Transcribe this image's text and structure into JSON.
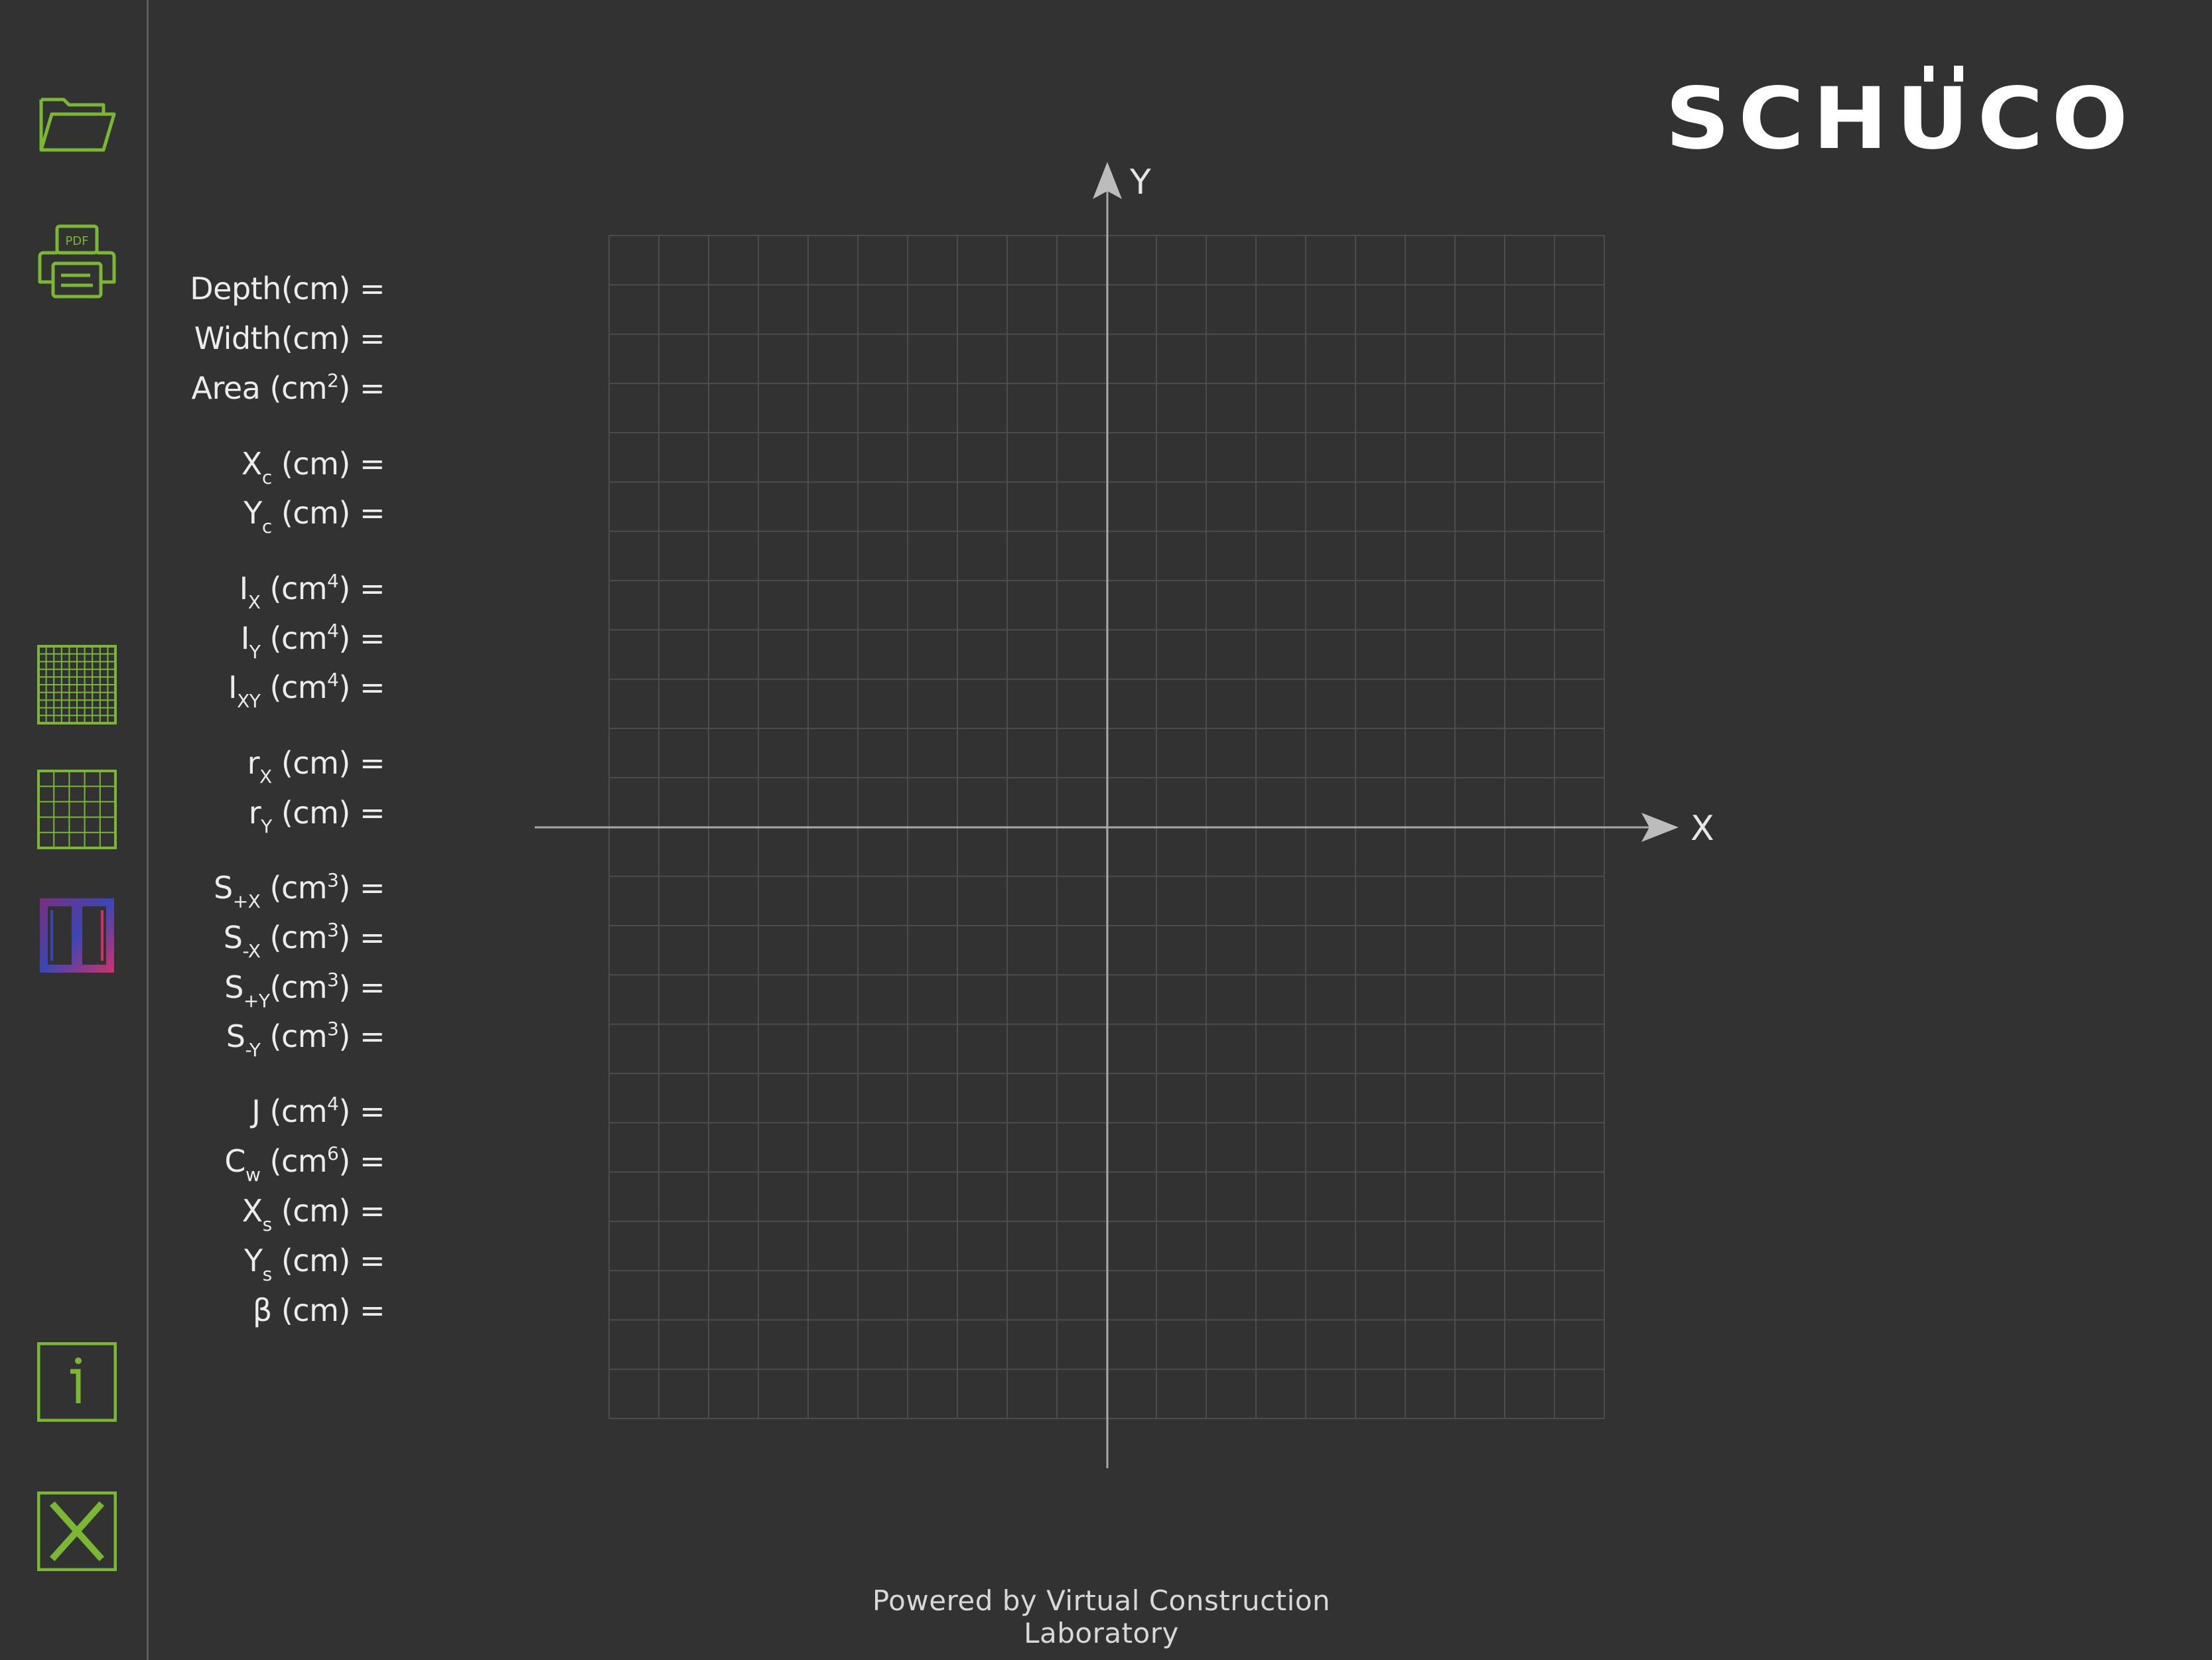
{
  "brand": {
    "logo_text": "SCHÜCO"
  },
  "sidebar": {
    "items": [
      {
        "name": "open-folder",
        "icon": "folder-icon"
      },
      {
        "name": "print-pdf",
        "icon": "pdf-printer-icon",
        "icon_text": "PDF"
      },
      {
        "name": "fine-grid",
        "icon": "fine-grid-icon"
      },
      {
        "name": "coarse-grid",
        "icon": "coarse-grid-icon"
      },
      {
        "name": "section-view",
        "icon": "section-profile-icon"
      },
      {
        "name": "info",
        "icon": "info-icon"
      },
      {
        "name": "close",
        "icon": "close-x-icon"
      }
    ],
    "accent_color": "#7ab833",
    "section_colors": [
      "#7a2f7f",
      "#3b46b5",
      "#d1306b"
    ]
  },
  "properties": [
    {
      "key": "depth",
      "main": "Depth(cm) ="
    },
    {
      "key": "width",
      "main": "Width(cm) ="
    },
    {
      "key": "area",
      "main": "Area (cm",
      "sup": "2",
      "tail": ") ="
    },
    {
      "key": "xc",
      "main": "X",
      "sub": "c",
      "tail": " (cm) ="
    },
    {
      "key": "yc",
      "main": "Y",
      "sub": "c",
      "tail": " (cm) ="
    },
    {
      "key": "ix",
      "main": "I",
      "sub": "X",
      "tail": " (cm",
      "sup": "4",
      "tail2": ") ="
    },
    {
      "key": "iy",
      "main": "I",
      "sub": "Y",
      "tail": " (cm",
      "sup": "4",
      "tail2": ") ="
    },
    {
      "key": "ixy",
      "main": "I",
      "sub": "XY",
      "tail": " (cm",
      "sup": "4",
      "tail2": ") ="
    },
    {
      "key": "rx",
      "main": "r",
      "sub": "X",
      "tail": " (cm) ="
    },
    {
      "key": "ry",
      "main": "r",
      "sub": "Y",
      "tail": " (cm) ="
    },
    {
      "key": "spx",
      "main": "S",
      "sub": "+X",
      "tail": " (cm",
      "sup": "3",
      "tail2": ") ="
    },
    {
      "key": "smx",
      "main": "S",
      "sub": "-X",
      "tail": " (cm",
      "sup": "3",
      "tail2": ") ="
    },
    {
      "key": "spy",
      "main": "S",
      "sub": "+Y",
      "tail": "(cm",
      "sup": "3",
      "tail2": ") ="
    },
    {
      "key": "smy",
      "main": "S",
      "sub": "-Y",
      "tail": " (cm",
      "sup": "3",
      "tail2": ") ="
    },
    {
      "key": "j",
      "main": "J (cm",
      "sup": "4",
      "tail": ") ="
    },
    {
      "key": "cw",
      "main": "C",
      "sub": "w",
      "tail": " (cm",
      "sup": "6",
      "tail2": ") ="
    },
    {
      "key": "xs",
      "main": "X",
      "sub": "s",
      "tail": " (cm) ="
    },
    {
      "key": "ys",
      "main": "Y",
      "sub": "s",
      "tail": " (cm) ="
    },
    {
      "key": "beta",
      "main": "β  (cm) ="
    }
  ],
  "plot": {
    "x_axis_label": "X",
    "y_axis_label": "Y",
    "grid_columns": 20,
    "grid_rows": 24,
    "grid_color": "#4c4c4c",
    "axis_color": "#a8a8a8"
  },
  "footer": {
    "text": "Powered by Virtual Construction Laboratory"
  }
}
